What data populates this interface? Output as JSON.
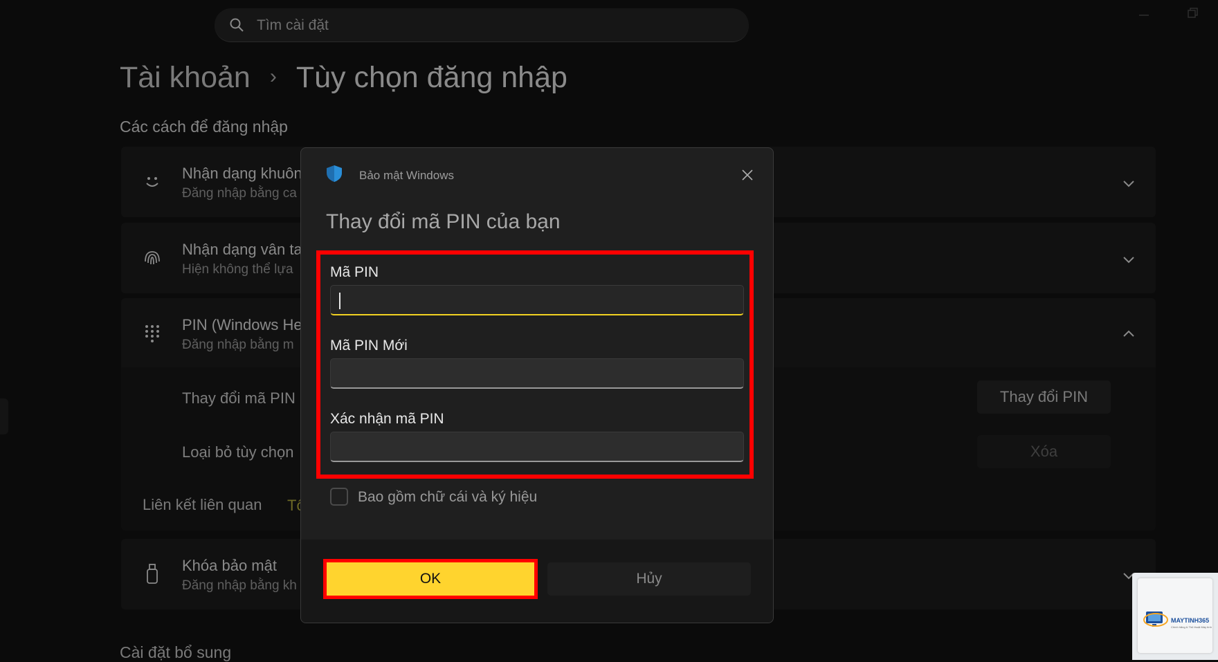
{
  "search": {
    "placeholder": "Tìm cài đặt",
    "icon": "search-icon"
  },
  "breadcrumb": {
    "parent": "Tài khoản",
    "separator": "›",
    "current": "Tùy chọn đăng nhập"
  },
  "section_title": "Các cách để đăng nhập",
  "sign_in_options": [
    {
      "title": "Nhận dạng khuôn",
      "subtitle": "Đăng nhập bằng ca",
      "icon": "face-icon"
    },
    {
      "title": "Nhận dạng vân ta",
      "subtitle": "Hiện không thể lựa",
      "icon": "fingerprint-icon"
    },
    {
      "title": "PIN (Windows He",
      "subtitle": "Đăng nhập bằng m",
      "icon": "keypad-icon"
    }
  ],
  "pin_subrows": {
    "change_label": "Thay đổi mã PIN",
    "change_button": "Thay đổi PIN",
    "remove_label": "Loại bỏ tùy chọn",
    "remove_button": "Xóa"
  },
  "related": {
    "label": "Liên kết liên quan",
    "link": "Tô"
  },
  "security_key": {
    "title": "Khóa bảo mật",
    "subtitle": "Đăng nhập bằng kh",
    "icon": "usb-key-icon"
  },
  "additional_settings": "Cài đặt bổ sung",
  "dialog": {
    "app_title": "Bảo mật Windows",
    "heading": "Thay đổi mã PIN của bạn",
    "fields": [
      {
        "label": "Mã PIN",
        "value": ""
      },
      {
        "label": "Mã PIN Mới",
        "value": ""
      },
      {
        "label": "Xác nhận mã PIN",
        "value": ""
      }
    ],
    "checkbox_label": "Bao gồm chữ cái và ký hiệu",
    "checkbox_checked": false,
    "ok_label": "OK",
    "cancel_label": "Hủy"
  },
  "watermark": {
    "brand": "MAYTINH365",
    "tagline": "Chính hãng & Thủ thuật Máy tính"
  },
  "colors": {
    "highlight": "#ff0000",
    "ok_button": "#ffd42e",
    "focus_underline": "#f2d222"
  }
}
